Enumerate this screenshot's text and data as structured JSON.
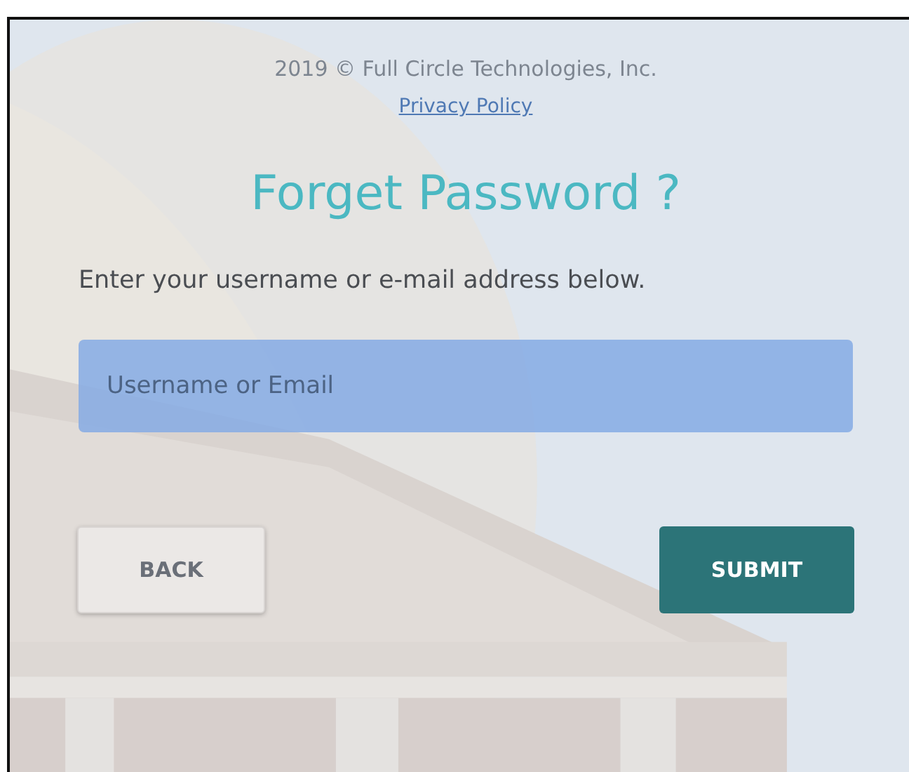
{
  "footer": {
    "copyright": "2019 © Full Circle Technologies, Inc.",
    "privacy_link": "Privacy Policy"
  },
  "title": "Forget Password ?",
  "instruction": "Enter your username or e-mail address below.",
  "field": {
    "placeholder": "Username or Email"
  },
  "buttons": [
    {
      "label": "BACK",
      "kind": "secondary"
    },
    {
      "label": "SUBMIT",
      "kind": "primary"
    }
  ]
}
